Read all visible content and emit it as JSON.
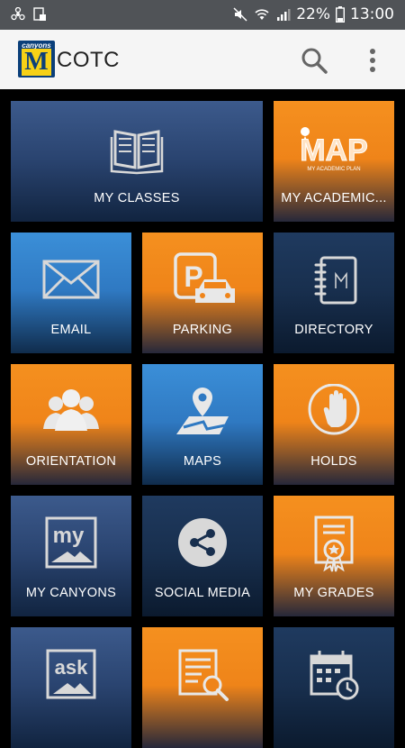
{
  "status_bar": {
    "battery": "22%",
    "time": "13:00"
  },
  "app_bar": {
    "logo_small": "canyons",
    "logo_letter": "M",
    "title": "COTC"
  },
  "tiles": [
    {
      "label": "MY CLASSES",
      "icon": "book-icon"
    },
    {
      "label": "MY ACADEMIC...",
      "icon": "map-academic-plan-icon",
      "icon_text": "MAP",
      "icon_subtext": "MY ACADEMIC PLAN"
    },
    {
      "label": "EMAIL",
      "icon": "envelope-icon"
    },
    {
      "label": "PARKING",
      "icon": "parking-icon"
    },
    {
      "label": "DIRECTORY",
      "icon": "notebook-icon"
    },
    {
      "label": "ORIENTATION",
      "icon": "people-icon"
    },
    {
      "label": "MAPS",
      "icon": "map-pin-icon"
    },
    {
      "label": "HOLDS",
      "icon": "hand-stop-icon"
    },
    {
      "label": "MY CANYONS",
      "icon": "my-canyons-icon",
      "icon_text": "my"
    },
    {
      "label": "SOCIAL MEDIA",
      "icon": "share-icon"
    },
    {
      "label": "MY GRADES",
      "icon": "certificate-icon"
    },
    {
      "label": "",
      "icon": "ask-icon",
      "icon_text": "ask"
    },
    {
      "label": "",
      "icon": "document-search-icon"
    },
    {
      "label": "",
      "icon": "calendar-clock-icon"
    }
  ],
  "colors": {
    "navy": "#2a4470",
    "orange": "#ef8419",
    "blue": "#2f79c2",
    "dark_navy": "#182f4e",
    "background": "#000000"
  }
}
